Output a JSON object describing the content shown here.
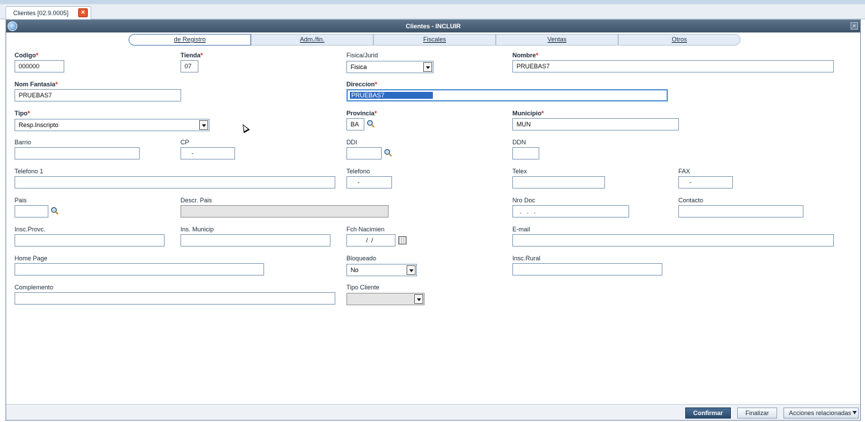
{
  "app_tab": {
    "label": "Clientes [02.9.0005]"
  },
  "window": {
    "title": "Clientes - INCLUIR"
  },
  "folders": [
    {
      "label": "de Registro",
      "active": true
    },
    {
      "label": "Adm./fin."
    },
    {
      "label": "Fiscales"
    },
    {
      "label": "Ventas"
    },
    {
      "label": "Otros"
    }
  ],
  "fields": {
    "codigo": {
      "label": "Codigo",
      "value": "000000"
    },
    "tienda": {
      "label": "Tienda",
      "value": "07"
    },
    "fisica_jurid": {
      "label": "Fisica/Jurid",
      "value": "Fisica"
    },
    "nombre": {
      "label": "Nombre",
      "value": "PRUEBAS7"
    },
    "nom_fantasia": {
      "label": "Nom Fantasia",
      "value": "PRUEBAS7"
    },
    "direccion": {
      "label": "Direccion",
      "value": "PRUEBAS7"
    },
    "tipo": {
      "label": "Tipo",
      "value": "Resp.Inscripto"
    },
    "provincia": {
      "label": "Provincia",
      "value": "BA"
    },
    "municipio": {
      "label": "Municipio",
      "value": "MUN"
    },
    "barrio": {
      "label": "Barrio",
      "value": ""
    },
    "cp": {
      "label": "CP",
      "value": "    -"
    },
    "ddi": {
      "label": "DDI",
      "value": ""
    },
    "ddn": {
      "label": "DDN",
      "value": ""
    },
    "telefono1": {
      "label": "Telefono 1",
      "value": ""
    },
    "telefono": {
      "label": "Telefono",
      "value": "    -"
    },
    "telex": {
      "label": "Telex",
      "value": ""
    },
    "fax": {
      "label": "FAX",
      "value": "    -"
    },
    "pais": {
      "label": "Pais",
      "value": ""
    },
    "descr_pais": {
      "label": "Descr. Pais",
      "value": ""
    },
    "nro_doc": {
      "label": "Nro Doc",
      "value": "  .   .   ."
    },
    "contacto": {
      "label": "Contacto",
      "value": ""
    },
    "insc_provc": {
      "label": "Insc.Provc.",
      "value": ""
    },
    "ins_municip": {
      "label": "Ins. Municip",
      "value": ""
    },
    "fch_nacimien": {
      "label": "Fch Nacimien",
      "value": "         /  /"
    },
    "email": {
      "label": "E-mail",
      "value": ""
    },
    "home_page": {
      "label": "Home Page",
      "value": ""
    },
    "bloqueado": {
      "label": "Bloqueado",
      "value": "No"
    },
    "insc_rural": {
      "label": "Insc.Rural",
      "value": ""
    },
    "complemento": {
      "label": "Complemento",
      "value": ""
    },
    "tipo_cliente": {
      "label": "Tipo Cliente",
      "value": ""
    }
  },
  "required_marker": "*",
  "buttons": {
    "confirmar": "Confirmar",
    "finalizar": "Finalizar",
    "acciones": "Acciones relacionadas"
  }
}
